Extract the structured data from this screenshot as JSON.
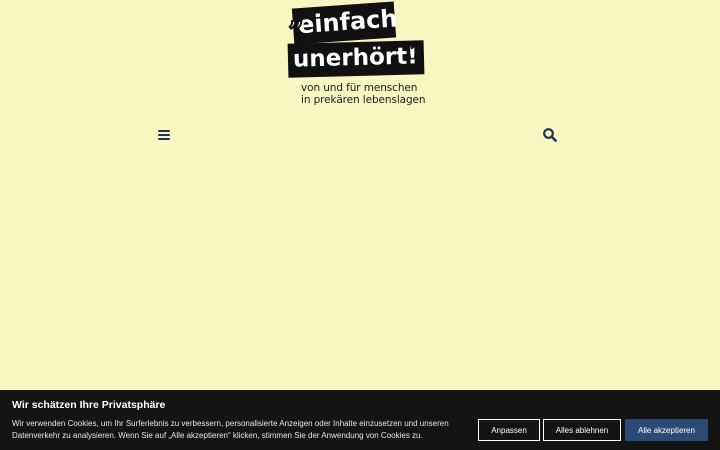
{
  "logo": {
    "quote_open": "„",
    "line1": "einfach",
    "line2": "unerhört!",
    "quote_close": "”",
    "tagline_line1": "von und für menschen",
    "tagline_line2": "in prekären lebenslagen"
  },
  "header": {
    "menu_icon": "hamburger-menu-icon",
    "search_icon": "search-icon",
    "icon_color": "#1f3558"
  },
  "cookie_banner": {
    "title": "Wir schätzen Ihre Privatsphäre",
    "text": "Wir verwenden Cookies, um Ihr Surferlebnis zu verbessern, personalisierte Anzeigen oder Inhalte einzusetzen und unseren Datenverkehr zu analysieren. Wenn Sie auf „Alle akzeptieren“ klicken, stimmen Sie der Anwendung von Cookies zu.",
    "buttons": {
      "customize": "Anpassen",
      "reject_all": "Alles ablehnen",
      "accept_all": "Alle akzeptieren"
    },
    "accent_color": "#2b4a74"
  },
  "colors": {
    "page_background": "#f9f6c2",
    "banner_background": "#141414"
  }
}
